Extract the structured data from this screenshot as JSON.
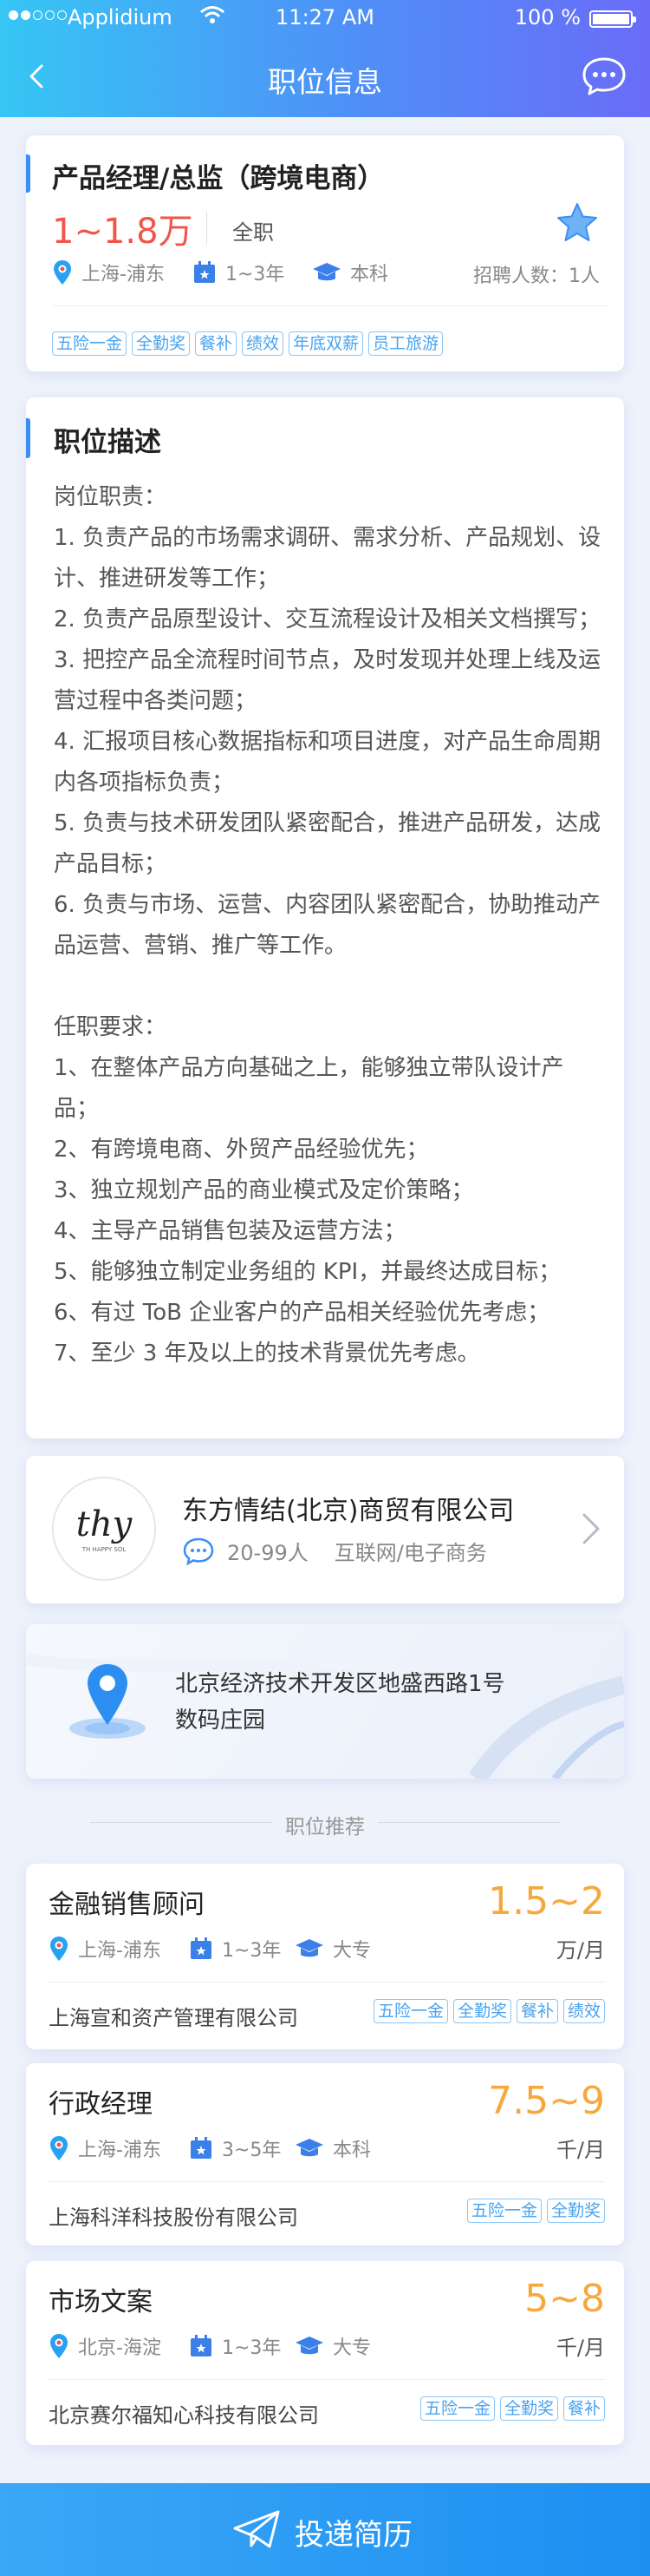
{
  "status_bar": {
    "carrier": "Applidium",
    "time": "11:27 AM",
    "battery": "100 %"
  },
  "nav": {
    "title": "职位信息"
  },
  "job": {
    "title": "产品经理/总监（跨境电商）",
    "salary": "1~1.8万",
    "type": "全职",
    "location": "上海-浦东",
    "experience": "1~3年",
    "education": "本科",
    "headcount": "招聘人数：1人",
    "tags": [
      "五险一金",
      "全勤奖",
      "餐补",
      "绩效",
      "年底双薪",
      "员工旅游"
    ]
  },
  "description": {
    "heading": "职位描述",
    "text": "岗位职责：\n1. 负责产品的市场需求调研、需求分析、产品规划、设计、推进研发等工作；\n2. 负责产品原型设计、交互流程设计及相关文档撰写；\n3. 把控产品全流程时间节点，及时发现并处理上线及运营过程中各类问题；\n4. 汇报项目核心数据指标和项目进度，对产品生命周期内各项指标负责；\n5. 负责与技术研发团队紧密配合，推进产品研发，达成产品目标；\n6. 负责与市场、运营、内容团队紧密配合，协助推动产品运营、营销、推广等工作。\n\n任职要求：\n1、在整体产品方向基础之上，能够独立带队设计产品；\n2、有跨境电商、外贸产品经验优先；\n3、独立规划产品的商业模式及定价策略；\n4、主导产品销售包装及运营方法；\n5、能够独立制定业务组的 KPI，并最终达成目标；\n6、有过 ToB 企业客户的产品相关经验优先考虑；\n7、至少 3 年及以上的技术背景优先考虑。"
  },
  "company": {
    "logo_text": "thy",
    "logo_subtext": "TH HAPPY SOL",
    "name": "东方情结(北京)商贸有限公司",
    "size": "20-99人",
    "industry": "互联网/电子商务"
  },
  "address": {
    "line1": "北京经济技术开发区地盛西路1号",
    "line2": "数码庄园"
  },
  "recommend": {
    "heading": "职位推荐",
    "jobs": [
      {
        "title": "金融销售顾问",
        "salary": "1.5~2",
        "unit": "万/月",
        "location": "上海-浦东",
        "experience": "1~3年",
        "education": "大专",
        "company": "上海宣和资产管理有限公司",
        "tags": [
          "五险一金",
          "全勤奖",
          "餐补",
          "绩效"
        ]
      },
      {
        "title": "行政经理",
        "salary": "7.5~9",
        "unit": "千/月",
        "location": "上海-浦东",
        "experience": "3~5年",
        "education": "本科",
        "company": "上海科洋科技股份有限公司",
        "tags": [
          "五险一金",
          "全勤奖"
        ]
      },
      {
        "title": "市场文案",
        "salary": "5~8",
        "unit": "千/月",
        "location": "北京-海淀",
        "experience": "1~3年",
        "education": "大专",
        "company": "北京赛尔福知心科技有限公司",
        "tags": [
          "五险一金",
          "全勤奖",
          "餐补"
        ]
      }
    ]
  },
  "apply": {
    "label": "投递简历"
  },
  "colors": {
    "primary": "#3a8ef6",
    "salary_red": "#f0554a",
    "salary_orange": "#f7a83c",
    "tag_blue": "#4aa3ef",
    "location_pin": "#27a2f2",
    "calendar": "#3b7fe8"
  }
}
